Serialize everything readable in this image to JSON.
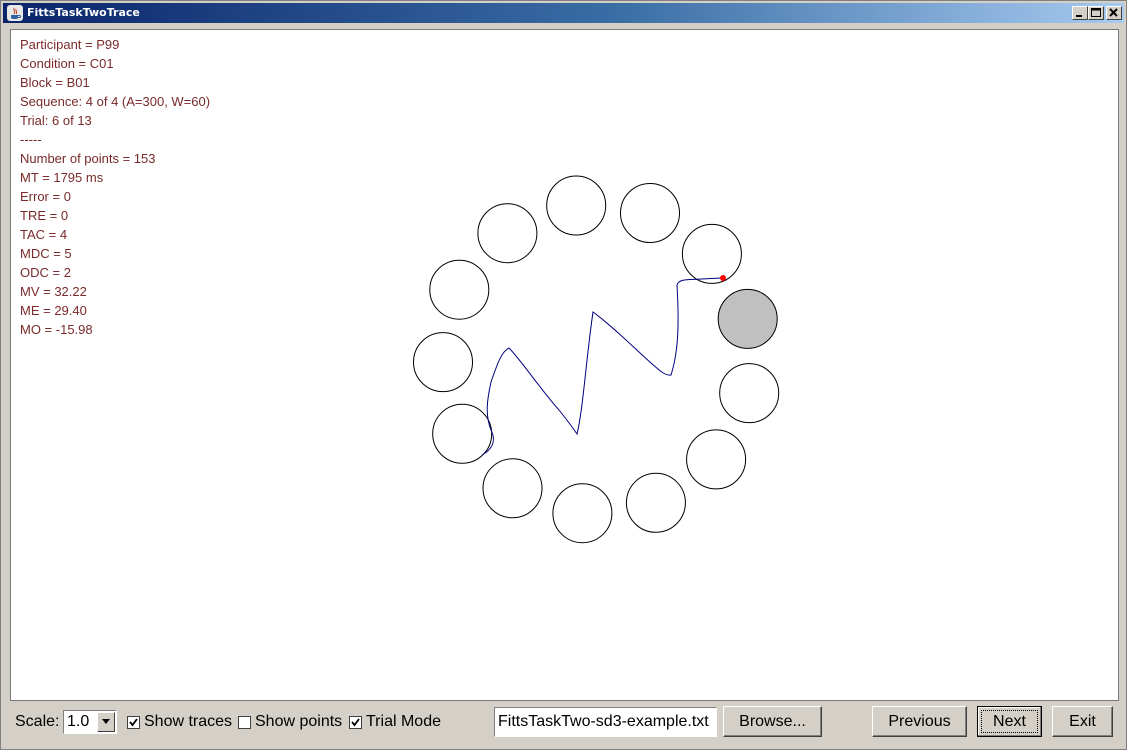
{
  "window": {
    "title": "FittsTaskTwoTrace"
  },
  "info": {
    "lines": [
      "Participant = P99",
      "Condition = C01",
      "Block = B01",
      "Sequence: 4 of 4 (A=300, W=60)",
      "Trial: 6 of 13",
      "-----",
      "Number of points = 153",
      "MT = 1795 ms",
      "Error = 0",
      "TRE = 0",
      "TAC = 4",
      "MDC = 5",
      "ODC = 2",
      "MV = 32.22",
      "ME = 29.40",
      "MO = -15.98"
    ]
  },
  "targets": {
    "count": 13,
    "highlighted_index": 0,
    "highlight_color": "#c0c0c0",
    "trace_color": "#000080",
    "point_color": "#ff0000"
  },
  "controls": {
    "scale_label": "Scale:",
    "scale_value": "1.0",
    "show_traces_label": "Show traces",
    "show_traces_checked": true,
    "show_points_label": "Show points",
    "show_points_checked": false,
    "trial_mode_label": "Trial Mode",
    "trial_mode_checked": true,
    "file_name": "FittsTaskTwo-sd3-example.txt",
    "browse_label": "Browse...",
    "previous_label": "Previous",
    "next_label": "Next",
    "exit_label": "Exit"
  }
}
